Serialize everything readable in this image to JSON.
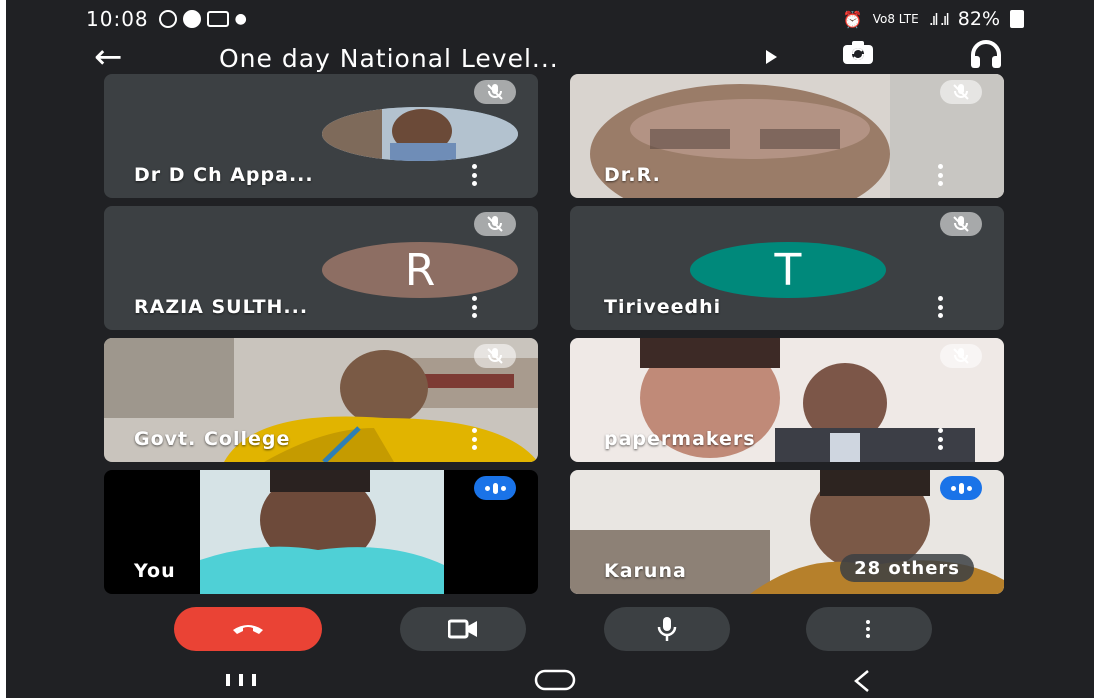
{
  "status_bar": {
    "time": "10:08",
    "network": "Vo8 LTE",
    "battery": "82%"
  },
  "meeting": {
    "title": "One day National Level..."
  },
  "participants": [
    {
      "name": "Dr D Ch Appa...",
      "muted": true,
      "view": "photo"
    },
    {
      "name": "Dr.R.",
      "muted": true,
      "view": "video"
    },
    {
      "name": "RAZIA SULTH...",
      "muted": true,
      "view": "avatar",
      "initial": "R",
      "avatar_color": "#8d6e63"
    },
    {
      "name": "Tiriveedhi",
      "muted": true,
      "view": "avatar",
      "initial": "T",
      "avatar_color": "#00897b"
    },
    {
      "name": "Govt. College",
      "muted": true,
      "view": "video"
    },
    {
      "name": "papermakers",
      "muted": true,
      "view": "video"
    },
    {
      "name": "You",
      "muted": false,
      "speaking": true,
      "view": "video"
    },
    {
      "name": "Karuna",
      "muted": false,
      "speaking": true,
      "view": "video"
    }
  ],
  "others_badge": "28 others",
  "icons": {
    "back": "arrow-left-icon",
    "present": "play-icon",
    "flip_camera": "camera-flip-icon",
    "audio": "headphones-icon",
    "end_call": "phone-hangup-icon",
    "camera": "videocam-icon",
    "microphone": "mic-icon",
    "more": "more-vert-icon"
  },
  "colors": {
    "background": "#202124",
    "tile": "#3c4043",
    "end_call": "#ea4335",
    "speaking": "#1a73e8"
  }
}
